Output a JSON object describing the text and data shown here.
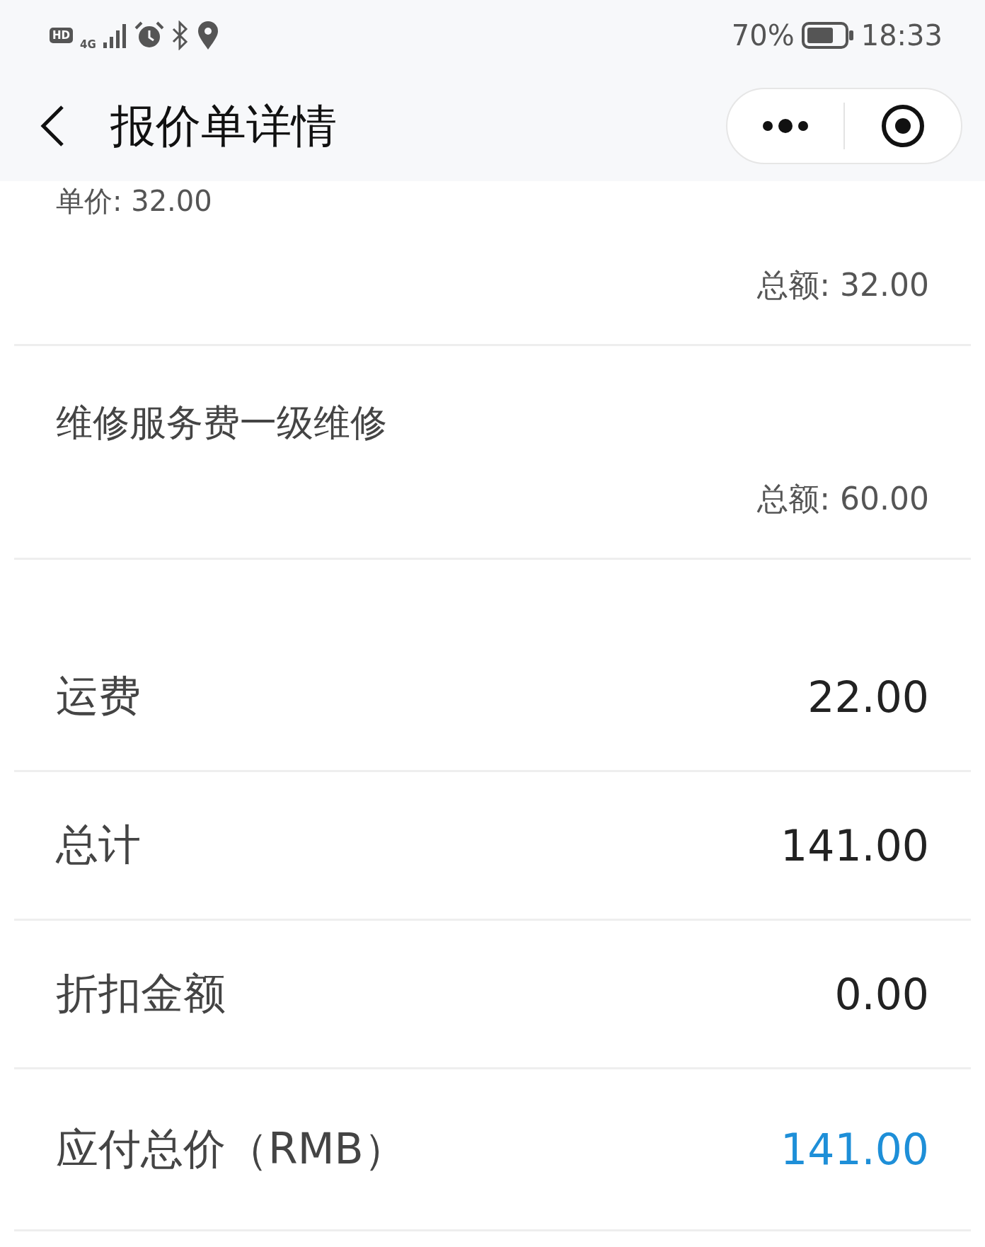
{
  "status_bar": {
    "hd": "HD",
    "network": "4G",
    "battery": "70%",
    "time": "18:33"
  },
  "nav": {
    "title": "报价单详情"
  },
  "items": [
    {
      "unit_price": "单价: 32.00",
      "total": "总额: 32.00"
    },
    {
      "name": "维修服务费一级维修",
      "total": "总额: 60.00"
    }
  ],
  "summary": [
    {
      "label": "运费",
      "value": "22.00",
      "highlight": false
    },
    {
      "label": "总计",
      "value": "141.00",
      "highlight": false
    },
    {
      "label": "折扣金额",
      "value": "0.00",
      "highlight": false
    },
    {
      "label": "应付总价（RMB）",
      "value": "141.00",
      "highlight": true
    }
  ]
}
